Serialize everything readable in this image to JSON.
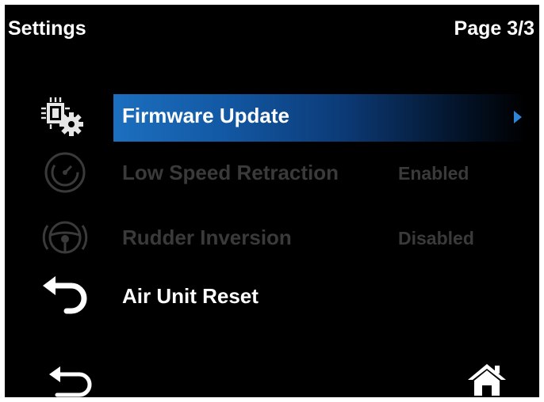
{
  "header": {
    "title": "Settings",
    "page": "Page 3/3"
  },
  "menu": {
    "items": [
      {
        "label": "Firmware Update",
        "value": "",
        "icon": "firmware-chip-gear-icon",
        "state": "selected"
      },
      {
        "label": "Low Speed Retraction",
        "value": "Enabled",
        "icon": "speed-dial-icon",
        "state": "disabled"
      },
      {
        "label": "Rudder Inversion",
        "value": "Disabled",
        "icon": "steering-wheel-icon",
        "state": "disabled"
      },
      {
        "label": "Air Unit Reset",
        "value": "",
        "icon": "reset-arrow-icon",
        "state": "normal"
      }
    ]
  },
  "footer": {
    "back_icon": "back-arrow-icon",
    "home_icon": "home-icon"
  },
  "colors": {
    "background": "#000000",
    "selected_start": "#1c6fbf",
    "selected_end": "#000000",
    "chevron": "#2f86d8",
    "text": "#ffffff",
    "disabled_text": "#3a3a3a"
  }
}
